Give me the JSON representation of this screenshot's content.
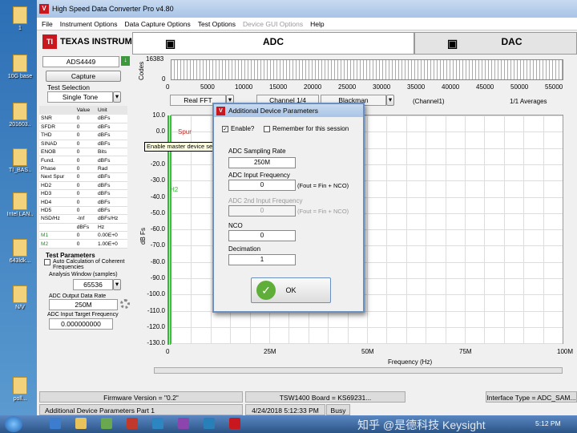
{
  "desktop": {
    "icons": [
      "1",
      "10G base",
      "201603..",
      "TI_BAS..",
      "Intel LAN..",
      "643ldk...",
      "N/V",
      "poll..."
    ]
  },
  "window": {
    "title": "High Speed Data Converter Pro v4.80"
  },
  "menu": [
    "File",
    "Instrument Options",
    "Data Capture Options",
    "Test Options",
    "Device GUI Options",
    "Help"
  ],
  "left": {
    "logo_text": "TEXAS INSTRUMENTS",
    "device": "ADS4449",
    "capture_label": "Capture",
    "test_selection_label": "Test Selection",
    "test_selection_value": "Single Tone",
    "table_headers": [
      "",
      "Value",
      "Unit"
    ],
    "rows": [
      [
        "SNR",
        "0",
        "dBFs"
      ],
      [
        "SFDR",
        "0",
        "dBFs"
      ],
      [
        "THD",
        "0",
        "dBFs"
      ],
      [
        "SINAD",
        "0",
        "dBFs"
      ],
      [
        "ENOB",
        "0",
        "Bits"
      ],
      [
        "Fund.",
        "0",
        "dBFs"
      ],
      [
        "Phase",
        "0",
        "Rad"
      ],
      [
        "Next Spur",
        "0",
        "dBFs"
      ],
      [
        "HD2",
        "0",
        "dBFs"
      ],
      [
        "HD3",
        "0",
        "dBFs"
      ],
      [
        "HD4",
        "0",
        "dBFs"
      ],
      [
        "HD5",
        "0",
        "dBFs"
      ],
      [
        "NSD/Hz",
        "-Inf",
        "dBFs/Hz"
      ],
      [
        "",
        "dBFs",
        "Hz"
      ],
      [
        "M1",
        "0",
        "0.00E+0"
      ],
      [
        "M2",
        "0",
        "1.00E+0"
      ]
    ],
    "test_params": "Test Parameters",
    "auto_calc": "Auto Calculation of Coherent Frequencies",
    "analysis_window": "Analysis Window (samples)",
    "analysis_value": "65536",
    "adc_output_rate": "ADC Output Data Rate",
    "adc_output_value": "250M",
    "adc_input_target": "ADC Input Target Frequency",
    "adc_input_target_value": "0.000000000"
  },
  "tabs": {
    "adc": "ADC",
    "dac": "DAC"
  },
  "codes": {
    "label": "Codes",
    "max": "16383",
    "zero": "0",
    "ticks": [
      "0",
      "5000",
      "10000",
      "15000",
      "20000",
      "25000",
      "30000",
      "35000",
      "40000",
      "45000",
      "50000",
      "55000"
    ]
  },
  "controls": {
    "fft": "Real FFT",
    "channel": "Channel 1/4",
    "window": "Blackman",
    "channel_label": "(Channel1)",
    "averages": "1/1 Averages"
  },
  "plot": {
    "ylabel": "dB Fs",
    "xlabel": "Frequency (Hz)",
    "yticks": [
      "10.0",
      "0.0",
      "-10.0",
      "-20.0",
      "-30.0",
      "-40.0",
      "-50.0",
      "-60.0",
      "-70.0",
      "-80.0",
      "-90.0",
      "-100.0",
      "-110.0",
      "-120.0",
      "-130.0"
    ],
    "xticks": [
      "0",
      "25M",
      "50M",
      "75M",
      "100M"
    ],
    "spur": "Spur",
    "h2": "H2"
  },
  "tooltip": "Enable master device settings for the device parameters.",
  "dialog": {
    "title": "Additional Device Parameters",
    "enable": "Enable?",
    "remember": "Remember for this session",
    "sampling_label": "ADC Sampling Rate",
    "sampling_value": "250M",
    "input_freq_label": "ADC Input  Frequency",
    "input_freq_value": "0",
    "fout1": "(Fout = Fin + NCO)",
    "input2_label": "ADC 2nd Input  Frequency",
    "input2_value": "0",
    "fout2": "(Fout = Fin + NCO)",
    "nco_label": "NCO",
    "nco_value": "0",
    "decimation_label": "Decimation",
    "decimation_value": "1",
    "ok": "OK"
  },
  "status": {
    "firmware": "Firmware Version = \"0.2\"",
    "board": "TSW1400 Board = KS69231...",
    "interface": "Interface Type = ADC_SAM...",
    "part": "Additional Device Parameters Part 1",
    "date": "4/24/2018 5:12:33 PM",
    "busy": "Busy"
  },
  "taskbar": {
    "time": "5:12 PM",
    "watermark": "知乎 @是德科技 Keysight"
  }
}
